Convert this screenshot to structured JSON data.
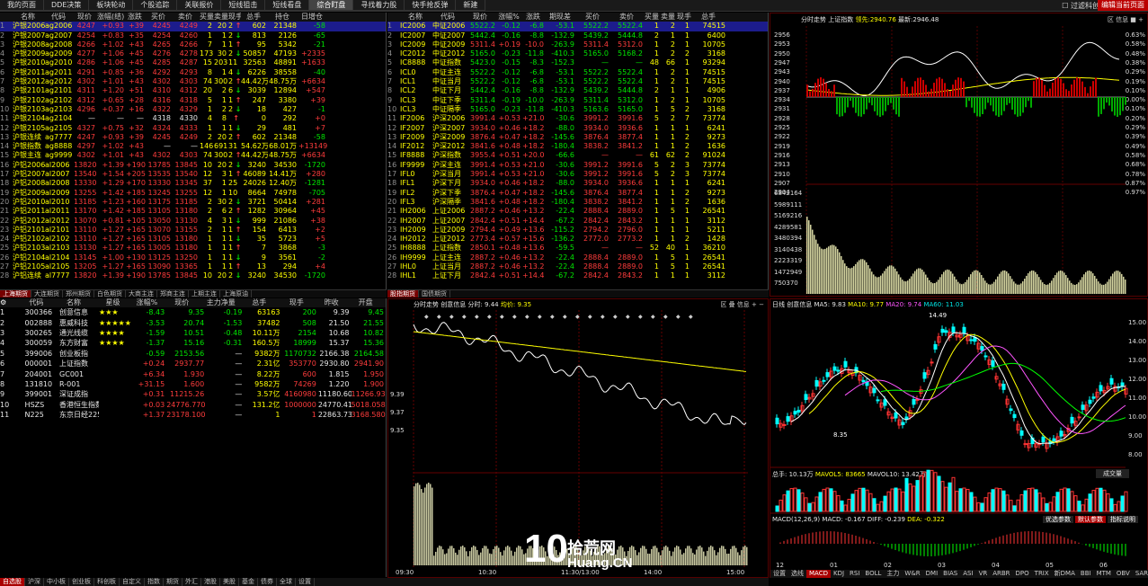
{
  "topbar": {
    "tabs": [
      "我的页面",
      "DDE决策",
      "板块轮动",
      "个股追踪",
      "关联报价",
      "短线狙击",
      "短线看盘",
      "综合盯盘",
      "寻找着力股",
      "快手抢反弹",
      "新建"
    ],
    "active": 7,
    "check_label": "过滤科创板",
    "edit_button": "编辑当前页面"
  },
  "futures": {
    "headers": [
      "名称",
      "代码",
      "现价",
      "涨幅(结)",
      "涨跌",
      "买价",
      "卖价",
      "买量",
      "卖量",
      "现手",
      "总手",
      "持仓",
      "日增仓"
    ],
    "rows": [
      [
        "1",
        "沪银2006",
        "ag2006",
        "4247",
        "+0.93",
        "+39",
        "4245",
        "4249",
        "2",
        "20",
        "2",
        "602",
        "21348",
        "-58"
      ],
      [
        "2",
        "沪银2007",
        "ag2007",
        "4254",
        "+0.83",
        "+35",
        "4254",
        "4260",
        "1",
        "1",
        "2",
        "813",
        "2126",
        "-65"
      ],
      [
        "3",
        "沪银2008",
        "ag2008",
        "4266",
        "+1.02",
        "+43",
        "4265",
        "4266",
        "7",
        "1",
        "1",
        "95",
        "5342",
        "-21"
      ],
      [
        "4",
        "沪银2009",
        "ag2009",
        "4277",
        "+1.06",
        "+45",
        "4276",
        "4278",
        "173",
        "30",
        "2",
        "50857",
        "47193",
        "+2335"
      ],
      [
        "5",
        "沪银2010",
        "ag2010",
        "4286",
        "+1.06",
        "+45",
        "4285",
        "4287",
        "15",
        "203",
        "11",
        "32563",
        "48891",
        "+1633"
      ],
      [
        "6",
        "沪银2011",
        "ag2011",
        "4291",
        "+0.85",
        "+36",
        "4292",
        "4293",
        "8",
        "1",
        "4",
        "6226",
        "38558",
        "-40"
      ],
      [
        "7",
        "沪银2012",
        "ag2012",
        "4302",
        "+1.01",
        "+43",
        "4302",
        "4303",
        "74",
        "300",
        "2",
        "44.42万",
        "48.75万",
        "+6634"
      ],
      [
        "8",
        "沪银2101",
        "ag2101",
        "4311",
        "+1.20",
        "+51",
        "4310",
        "4312",
        "20",
        "2",
        "6",
        "3039",
        "12894",
        "+547"
      ],
      [
        "9",
        "沪银2102",
        "ag2102",
        "4312",
        "+0.65",
        "+28",
        "4316",
        "4318",
        "5",
        "1",
        "1",
        "247",
        "3380",
        "+39"
      ],
      [
        "10",
        "沪银2103",
        "ag2103",
        "4296",
        "+0.37",
        "+16",
        "4322",
        "4329",
        "1",
        "2",
        "2",
        "18",
        "427",
        "-1"
      ],
      [
        "11",
        "沪银2104",
        "ag2104",
        "—",
        "—",
        "—",
        "4318",
        "4330",
        "4",
        "8",
        "",
        "0",
        "292",
        "+0"
      ],
      [
        "12",
        "沪银2105",
        "ag2105",
        "4327",
        "+0.75",
        "+32",
        "4324",
        "4333",
        "1",
        "1",
        "1",
        "29",
        "481",
        "+7"
      ],
      [
        "13",
        "沪银连续",
        "ag7777",
        "4247",
        "+0.93",
        "+39",
        "4245",
        "4249",
        "2",
        "20",
        "2",
        "602",
        "21348",
        "-58"
      ],
      [
        "14",
        "沪银指数",
        "ag8888",
        "4297",
        "+1.02",
        "+43",
        "—",
        "—",
        "146",
        "691",
        "31",
        "54.62万",
        "68.01万",
        "+13149"
      ],
      [
        "15",
        "沪银主连",
        "ag9999",
        "4302",
        "+1.01",
        "+43",
        "4302",
        "4303",
        "74",
        "300",
        "2",
        "44.42万",
        "48.75万",
        "+6634"
      ],
      [
        "16",
        "沪铝2006",
        "al2006",
        "13820",
        "+1.39",
        "+190",
        "13785",
        "13845",
        "10",
        "20",
        "2",
        "3240",
        "34530",
        "-1720"
      ],
      [
        "17",
        "沪铝2007",
        "al2007",
        "13540",
        "+1.54",
        "+205",
        "13535",
        "13540",
        "12",
        "3",
        "1",
        "46089",
        "14.41万",
        "+280"
      ],
      [
        "18",
        "沪铝2008",
        "al2008",
        "13330",
        "+1.29",
        "+170",
        "13330",
        "13345",
        "37",
        "1",
        "25",
        "24026",
        "12.40万",
        "-1281"
      ],
      [
        "19",
        "沪铝2009",
        "al2009",
        "13255",
        "+1.42",
        "+185",
        "13245",
        "13255",
        "12",
        "1",
        "10",
        "8664",
        "74978",
        "-705"
      ],
      [
        "20",
        "沪铝2010",
        "al2010",
        "13185",
        "+1.23",
        "+160",
        "13175",
        "13185",
        "2",
        "30",
        "2",
        "3721",
        "50414",
        "+281"
      ],
      [
        "21",
        "沪铝2011",
        "al2011",
        "13170",
        "+1.42",
        "+185",
        "13105",
        "13180",
        "2",
        "6",
        "2",
        "1282",
        "30964",
        "+45"
      ],
      [
        "22",
        "沪铝2012",
        "al2012",
        "13070",
        "+0.81",
        "+105",
        "13050",
        "13130",
        "4",
        "3",
        "1",
        "999",
        "21086",
        "+38"
      ],
      [
        "23",
        "沪铝2101",
        "al2101",
        "13110",
        "+1.27",
        "+165",
        "13070",
        "13155",
        "2",
        "1",
        "1",
        "154",
        "6413",
        "+2"
      ],
      [
        "24",
        "沪铝2102",
        "al2102",
        "13110",
        "+1.27",
        "+165",
        "13105",
        "13180",
        "1",
        "1",
        "1",
        "35",
        "5723",
        "+5"
      ],
      [
        "25",
        "沪铝2103",
        "al2103",
        "13130",
        "+1.27",
        "+165",
        "13005",
        "13180",
        "1",
        "1",
        "1",
        "7",
        "3868",
        "-3"
      ],
      [
        "26",
        "沪铝2104",
        "al2104",
        "13145",
        "+1.00",
        "+130",
        "13125",
        "13250",
        "1",
        "1",
        "1",
        "9",
        "3561",
        "-2"
      ],
      [
        "27",
        "沪铝2105",
        "al2105",
        "13205",
        "+1.27",
        "+165",
        "13090",
        "13365",
        "1",
        "1",
        "1",
        "13",
        "294",
        "+4"
      ],
      [
        "28",
        "沪铝连续",
        "al7777",
        "13820",
        "+1.39",
        "+190",
        "13785",
        "13845",
        "10",
        "20",
        "2",
        "3240",
        "34530",
        "-1720"
      ]
    ],
    "tabs": [
      "上海期货",
      "大连期货",
      "郑州期货",
      "白色期货",
      "大商主连",
      "郑商主连",
      "上期主连",
      "上海原油"
    ],
    "active_tab": 0
  },
  "index_futures": {
    "headers": [
      "名称",
      "代码",
      "现价",
      "涨幅%",
      "涨跌",
      "期现差",
      "买价",
      "卖价",
      "买量",
      "卖量",
      "现手",
      "总手"
    ],
    "rows": [
      [
        "1",
        "IC2006",
        "中证2006",
        "5522.2",
        "-0.12",
        "-6.8",
        "-53.1",
        "5522.2",
        "5522.4",
        "1",
        "2",
        "1",
        "74515"
      ],
      [
        "2",
        "IC2007",
        "中证2007",
        "5442.4",
        "-0.16",
        "-8.8",
        "-132.9",
        "5439.2",
        "5444.8",
        "2",
        "1",
        "1",
        "6400"
      ],
      [
        "3",
        "IC2009",
        "中证2009",
        "5311.4",
        "+0.19",
        "-10.0",
        "-263.9",
        "5311.4",
        "5312.0",
        "1",
        "2",
        "1",
        "10705"
      ],
      [
        "4",
        "IC2012",
        "中证2012",
        "5165.0",
        "-0.23",
        "-11.8",
        "-410.3",
        "5165.0",
        "5168.2",
        "1",
        "2",
        "2",
        "3168"
      ],
      [
        "5",
        "IC8888",
        "中证指数",
        "5423.0",
        "-0.15",
        "-8.3",
        "-152.3",
        "—",
        "—",
        "48",
        "66",
        "1",
        "93294"
      ],
      [
        "6",
        "ICL0",
        "中证主连",
        "5522.2",
        "-0.12",
        "-6.8",
        "-53.1",
        "5522.2",
        "5522.4",
        "1",
        "2",
        "1",
        "74515"
      ],
      [
        "7",
        "ICL1",
        "中证当月",
        "5522.2",
        "-0.12",
        "-6.8",
        "-53.1",
        "5522.2",
        "5522.4",
        "1",
        "2",
        "1",
        "74515"
      ],
      [
        "8",
        "ICL2",
        "中证下月",
        "5442.4",
        "-0.16",
        "-8.8",
        "-132.9",
        "5439.2",
        "5444.8",
        "2",
        "1",
        "1",
        "4906"
      ],
      [
        "9",
        "ICL3",
        "中证下季",
        "5311.4",
        "-0.19",
        "-10.0",
        "-263.9",
        "5311.4",
        "5312.0",
        "1",
        "2",
        "1",
        "10705"
      ],
      [
        "10",
        "ICL3",
        "中证隔季",
        "5165.0",
        "-0.23",
        "-11.8",
        "-410.3",
        "5163.6",
        "5165.0",
        "1",
        "5",
        "2",
        "3168"
      ],
      [
        "11",
        "IF2006",
        "沪深2006",
        "3991.4",
        "+0.53",
        "+21.0",
        "-30.6",
        "3991.2",
        "3991.6",
        "5",
        "2",
        "7",
        "73774"
      ],
      [
        "12",
        "IF2007",
        "沪深2007",
        "3934.0",
        "+0.46",
        "+18.2",
        "-88.0",
        "3934.0",
        "3936.6",
        "1",
        "1",
        "1",
        "6241"
      ],
      [
        "13",
        "IF2009",
        "沪深2009",
        "3876.4",
        "+0.47",
        "+18.2",
        "-145.6",
        "3876.4",
        "3877.4",
        "1",
        "1",
        "2",
        "9273"
      ],
      [
        "14",
        "IF2012",
        "沪深2012",
        "3841.6",
        "+0.48",
        "+18.2",
        "-180.4",
        "3838.2",
        "3841.2",
        "1",
        "1",
        "2",
        "1636"
      ],
      [
        "15",
        "IF8888",
        "沪深指数",
        "3955.4",
        "+0.51",
        "+20.0",
        "-66.6",
        "—",
        "—",
        "61",
        "62",
        "2",
        "91024"
      ],
      [
        "16",
        "IF9999",
        "沪深主连",
        "3991.4",
        "+0.53",
        "+21.0",
        "-30.6",
        "3991.2",
        "3991.6",
        "5",
        "2",
        "3",
        "73774"
      ],
      [
        "17",
        "IFL0",
        "沪深当月",
        "3991.4",
        "+0.53",
        "+21.0",
        "-30.6",
        "3991.2",
        "3991.6",
        "5",
        "2",
        "3",
        "73774"
      ],
      [
        "18",
        "IFL1",
        "沪深下月",
        "3934.0",
        "+0.46",
        "+18.2",
        "-88.0",
        "3934.0",
        "3936.6",
        "1",
        "1",
        "1",
        "6241"
      ],
      [
        "19",
        "IFL2",
        "沪深下季",
        "3876.4",
        "+0.47",
        "+18.2",
        "-145.6",
        "3876.4",
        "3877.4",
        "1",
        "1",
        "2",
        "9273"
      ],
      [
        "20",
        "IFL3",
        "沪深隔季",
        "3841.6",
        "+0.48",
        "+18.2",
        "-180.4",
        "3838.2",
        "3841.2",
        "1",
        "1",
        "2",
        "1636"
      ],
      [
        "21",
        "IH2006",
        "上证2006",
        "2887.2",
        "+0.46",
        "+13.2",
        "-22.4",
        "2888.4",
        "2889.0",
        "1",
        "5",
        "1",
        "26541"
      ],
      [
        "22",
        "IH2007",
        "上证2007",
        "2842.4",
        "+0.51",
        "+14.4",
        "-67.2",
        "2842.4",
        "2843.2",
        "1",
        "1",
        "1",
        "3112"
      ],
      [
        "23",
        "IH2009",
        "上证2009",
        "2794.4",
        "+0.49",
        "+13.6",
        "-115.2",
        "2794.2",
        "2796.0",
        "1",
        "1",
        "1",
        "5211"
      ],
      [
        "24",
        "IH2012",
        "上证2012",
        "2773.4",
        "+0.57",
        "+15.6",
        "-136.2",
        "2772.0",
        "2773.2",
        "1",
        "1",
        "2",
        "1428"
      ],
      [
        "25",
        "IH8888",
        "上证指数",
        "2850.1",
        "+0.48",
        "+13.6",
        "-59.5",
        "—",
        "—",
        "52",
        "40",
        "1",
        "36210"
      ],
      [
        "26",
        "IH9999",
        "上证主连",
        "2887.2",
        "+0.46",
        "+13.2",
        "-22.4",
        "2888.4",
        "2889.0",
        "1",
        "5",
        "1",
        "26541"
      ],
      [
        "27",
        "IHL0",
        "上证当月",
        "2887.2",
        "+0.46",
        "+13.2",
        "-22.4",
        "2888.4",
        "2889.0",
        "1",
        "5",
        "1",
        "26541"
      ],
      [
        "28",
        "IHL1",
        "上证下月",
        "2842.4",
        "+0.51",
        "+14.4",
        "-67.2",
        "2842.4",
        "2843.2",
        "1",
        "1",
        "1",
        "3112"
      ]
    ],
    "tabs": [
      "股指期货",
      "国债期货"
    ],
    "active_tab": 0
  },
  "watchlist": {
    "headers": [
      "代码",
      "名称",
      "星级",
      "涨幅%",
      "现价",
      "主力净量",
      "总手",
      "现手",
      "昨收",
      "开盘"
    ],
    "rows": [
      [
        "1",
        "300366",
        "创意信息",
        "★★★",
        "-8.43",
        "9.35",
        "-0.19",
        "63163",
        "200",
        "9.39",
        "9.45"
      ],
      [
        "2",
        "002888",
        "惠威科技",
        "★★★★★",
        "-3.53",
        "20.74",
        "-1.53",
        "37482",
        "508",
        "21.50",
        "21.55"
      ],
      [
        "3",
        "300265",
        "通光线缆",
        "★★★★",
        "-1.59",
        "10.51",
        "-0.48",
        "10.11万",
        "2154",
        "10.68",
        "10.82"
      ],
      [
        "4",
        "300059",
        "东方财富",
        "★★★★",
        "-1.37",
        "15.16",
        "-0.31",
        "160.5万",
        "18999",
        "15.37",
        "15.36"
      ],
      [
        "5",
        "399006",
        "创业板指",
        "",
        "-0.59",
        "2153.56",
        "—",
        "9382万",
        "1170732",
        "2166.38",
        "2164.58"
      ],
      [
        "6",
        "000001",
        "上证指数",
        "",
        "+0.24",
        "2937.77",
        "—",
        "2.31亿",
        "353770",
        "2930.80",
        "2941.90"
      ],
      [
        "7",
        "204001",
        "GC001",
        "",
        "+6.34",
        "1.930",
        "—",
        "8.22万",
        "600",
        "1.815",
        "1.950"
      ],
      [
        "8",
        "131810",
        "R-001",
        "",
        "+31.15",
        "1.600",
        "—",
        "9582万",
        "74269",
        "1.220",
        "1.900"
      ],
      [
        "9",
        "399001",
        "深证成指",
        "",
        "+0.31",
        "11215.26",
        "—",
        "3.57亿",
        "4160980",
        "11180.60",
        "11266.93"
      ],
      [
        "10",
        "HSZS",
        "香港恒生指数",
        "",
        "+0.03",
        "24776.770",
        "—",
        "131.2亿",
        "1000000",
        "24770.410",
        "5018.058"
      ],
      [
        "11",
        "N225",
        "东京日经225指数",
        "",
        "+1.37",
        "23178.100",
        "—",
        "1",
        "1",
        "22863.730",
        "3168.580"
      ]
    ],
    "bottom_tabs": [
      "自选股",
      "沪深",
      "中小板",
      "创业板",
      "科创板",
      "自定义",
      "指数",
      "期货",
      "外汇",
      "港股",
      "美股",
      "基金",
      "债券",
      "全球",
      "设置"
    ],
    "active_bottom": 0
  },
  "intraday": {
    "title": "分时走势",
    "stock": "创意信息",
    "price_label": "分时: 9.44",
    "avg_label": "均价: 9.35",
    "yaxis": [
      "9.39",
      "9.37",
      "9.35"
    ],
    "time_labels": [
      "09:30",
      "10:30",
      "11:30/13:00",
      "14:00",
      "15:00"
    ],
    "toolbar": [
      "区",
      "叠",
      "信息",
      "+",
      "−"
    ]
  },
  "index_intraday": {
    "title": "分时走势",
    "name": "上证指数",
    "pre_label": "领先:",
    "value1": "2940.76",
    "last_label": "最新:",
    "value2": "2946.48",
    "left_axis": [
      "2956",
      "2953",
      "2950",
      "2947",
      "2943",
      "2940",
      "2937",
      "2934",
      "2931",
      "2928",
      "2925",
      "2922",
      "2919",
      "2916",
      "2913",
      "2910",
      "2907",
      "2904"
    ],
    "right_axis": [
      "0.63%",
      "0.58%",
      "0.48%",
      "0.38%",
      "0.29%",
      "0.19%",
      "0.10%",
      "0.00%",
      "0.10%",
      "0.20%",
      "0.29%",
      "0.39%",
      "0.49%",
      "0.58%",
      "0.68%",
      "0.78%",
      "0.87%",
      "0.97%"
    ],
    "vol_axis": [
      "6842164",
      "5989111",
      "5169216",
      "4289581",
      "3480394",
      "3140438",
      "2223319",
      "1472949",
      "750370"
    ]
  },
  "kline": {
    "title": "日线",
    "stock": "创意信息",
    "ma5": "MA5: 9.83",
    "ma10": "MA10: 9.77",
    "ma20": "MA20: 9.74",
    "ma60": "MA60: 11.03",
    "high_label": "14.49",
    "low_label": "8.35",
    "axis": [
      "15.00",
      "14.00",
      "13.00",
      "12.00",
      "11.00",
      "10.00",
      "9.00",
      "8.00"
    ],
    "vol_title": "总手: 10.13万",
    "vol_ma5": "MAVOL5: 83665",
    "vol_ma10": "MAVOL10: 13.42万",
    "vol_select": "成交量",
    "macd_title": "MACD(12,26,9)",
    "macd_val": "MACD: -0.167",
    "diff": "DIFF: -0.239",
    "dea": "DEA: -0.322",
    "macd_btns": [
      "优选参数",
      "默认参数",
      "指标说明"
    ],
    "months": [
      "12",
      "01",
      "02",
      "03",
      "04",
      "05",
      "06"
    ],
    "ind_tabs": [
      "设置",
      "选线",
      "MACD",
      "KDJ",
      "RSI",
      "BOLL",
      "主力",
      "W&R",
      "DMI",
      "BIAS",
      "ASI",
      "VR",
      "ARBR",
      "DPO",
      "TRIX",
      "新DMA",
      "BBI",
      "MTM",
      "OBV",
      "SAR",
      "EX"
    ],
    "active_ind": 2
  },
  "watermark": {
    "big": "10",
    "site": "拾荒网",
    "domain": "Huang.CN"
  },
  "colors": {
    "up": "#ff3c3c",
    "down": "#00e600",
    "accent": "#ffff00"
  }
}
